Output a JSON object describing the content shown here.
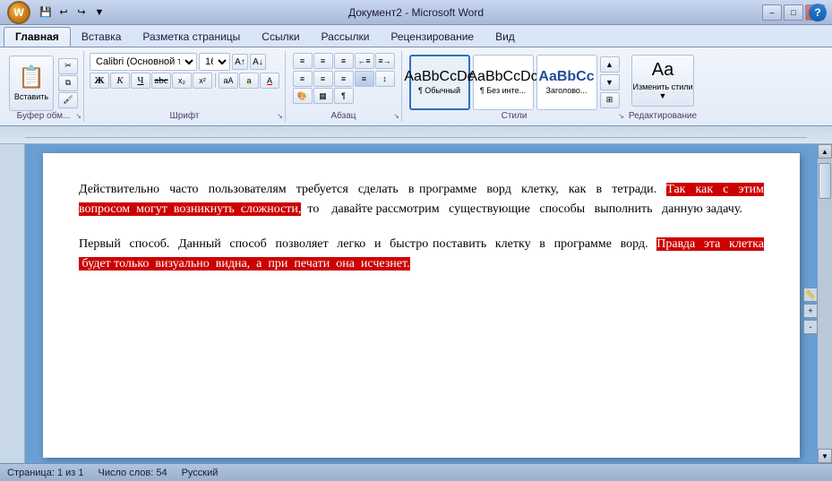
{
  "window": {
    "title": "Документ2 - Microsoft Word",
    "min_label": "–",
    "max_label": "□",
    "close_label": "✕"
  },
  "quickaccess": {
    "save": "💾",
    "undo": "↩",
    "redo": "↪",
    "dropdown": "▼"
  },
  "tabs": [
    {
      "id": "home",
      "label": "Главная",
      "active": true
    },
    {
      "id": "insert",
      "label": "Вставка",
      "active": false
    },
    {
      "id": "pagelayout",
      "label": "Разметка страницы",
      "active": false
    },
    {
      "id": "references",
      "label": "Ссылки",
      "active": false
    },
    {
      "id": "mailings",
      "label": "Рассылки",
      "active": false
    },
    {
      "id": "review",
      "label": "Рецензирование",
      "active": false
    },
    {
      "id": "view",
      "label": "Вид",
      "active": false
    }
  ],
  "ribbon": {
    "groups": {
      "clipboard": {
        "label": "Буфер обм...",
        "paste_label": "Вставить"
      },
      "font": {
        "label": "Шрифт",
        "font_name": "Calibri (Основной те...",
        "font_size": "16",
        "bold": "Ж",
        "italic": "К",
        "underline": "Ч",
        "strikethrough": "abc",
        "subscript": "х₂",
        "superscript": "х²",
        "highlight": "аА",
        "color": "А"
      },
      "paragraph": {
        "label": "Абзац"
      },
      "styles": {
        "label": "Стили",
        "items": [
          {
            "name": "Обычный",
            "preview": "¶",
            "active": true
          },
          {
            "name": "Без инте...",
            "preview": "¶",
            "active": false
          },
          {
            "name": "Заголово...",
            "preview": "AaBbCc",
            "active": false
          }
        ]
      },
      "editing": {
        "label": "Редактирование",
        "change_styles": "Изменить стили ▼"
      }
    }
  },
  "document": {
    "paragraphs": [
      {
        "id": "p1",
        "parts": [
          {
            "text": "Действительно  часто  пользователям  требуется  сделать  в программе  ворд  клетку,  как  в  тетради.  ",
            "highlight": false
          },
          {
            "text": "Так  как  с  этим  вопросом  могут  возникнуть  сложности,",
            "highlight": true
          },
          {
            "text": "  то   давайте рассмотрим   существующие   способы   выполнить   данную задачу.",
            "highlight": false
          }
        ]
      },
      {
        "id": "p2",
        "parts": [
          {
            "text": "Первый  способ.  Данный  способ  позволяет  легко  и  быстро поставить  клетку  в  программе  ворд.  ",
            "highlight": false
          },
          {
            "text": "Правда  эта  клетка  будет только  визуально  видна,  а  при  печати  она  исчезнет.",
            "highlight": true
          }
        ]
      }
    ]
  },
  "statusbar": {
    "page_info": "Страница: 1 из 1",
    "word_count": "Число слов: 54",
    "language": "Русский"
  }
}
